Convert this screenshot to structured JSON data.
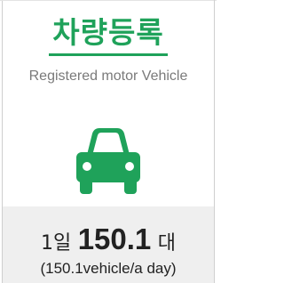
{
  "card": {
    "title": "차량등록",
    "subtitle": "Registered motor Vehicle",
    "icon": "car-icon",
    "accent_color": "#1fa25a",
    "stat": {
      "prefix": "1일",
      "value": "150.1",
      "unit": "대",
      "english": "(150.1vehicle/a day)"
    }
  }
}
